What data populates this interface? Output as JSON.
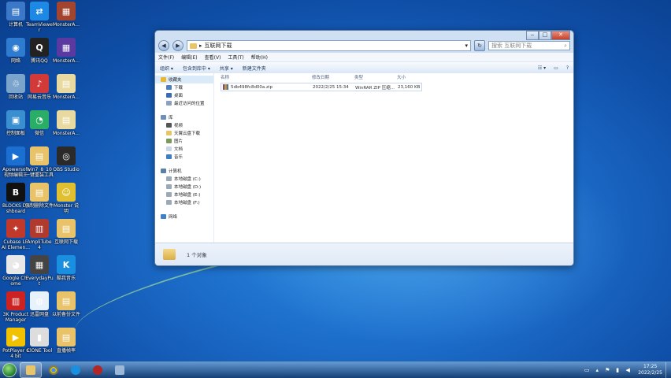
{
  "desktop_icons": [
    {
      "label": "计算机",
      "color": "#3b78c8",
      "glyph": "▤"
    },
    {
      "label": "TeamViewer",
      "color": "#1e88e5",
      "glyph": "⇄"
    },
    {
      "label": "MonsterA...",
      "color": "#a3442e",
      "glyph": "▦"
    },
    {
      "label": "网络",
      "color": "#2f7bd0",
      "glyph": "◉"
    },
    {
      "label": "腾讯QQ",
      "color": "#222",
      "glyph": "Q"
    },
    {
      "label": "MonsterA...",
      "color": "#5a3aa0",
      "glyph": "▦"
    },
    {
      "label": "回收站",
      "color": "#7aa4cc",
      "glyph": "♲"
    },
    {
      "label": "网易云音乐",
      "color": "#d23a3a",
      "glyph": "♪"
    },
    {
      "label": "MonsterA...",
      "color": "#e8d9a0",
      "glyph": "▤"
    },
    {
      "label": "控制面板",
      "color": "#3a8fd0",
      "glyph": "▣"
    },
    {
      "label": "微信",
      "color": "#2aae67",
      "glyph": "◔"
    },
    {
      "label": "MonsterA...",
      "color": "#e8d9a0",
      "glyph": "▤"
    },
    {
      "label": "Apowersoft视频编辑王",
      "color": "#1b6fd1",
      "glyph": "▶"
    },
    {
      "label": "win7_8_10一键重装工具",
      "color": "#e8c36a",
      "glyph": "▤"
    },
    {
      "label": "OBS Studio",
      "color": "#2a2a2a",
      "glyph": "◎"
    },
    {
      "label": "BLOCKS Dashboard",
      "color": "#111",
      "glyph": "B"
    },
    {
      "label": "强制删除文件",
      "color": "#e8c36a",
      "glyph": "▤"
    },
    {
      "label": "Monster 说明",
      "color": "#e0c030",
      "glyph": "☺"
    },
    {
      "label": "Cubase LE AI Elemen...",
      "color": "#c0392b",
      "glyph": "✦"
    },
    {
      "label": "AmpliTube 4",
      "color": "#b03a2e",
      "glyph": "▥"
    },
    {
      "label": "互联网下载",
      "color": "#e8c36a",
      "glyph": "▤"
    },
    {
      "label": "Google Chrome",
      "color": "#e8e8e8",
      "glyph": "◕"
    },
    {
      "label": "EverydayPut",
      "color": "#444",
      "glyph": "▦"
    },
    {
      "label": "酷我音乐",
      "color": "#1a8fe0",
      "glyph": "K"
    },
    {
      "label": "3K Product Manager",
      "color": "#c22",
      "glyph": "▥"
    },
    {
      "label": "迅雷网盘",
      "color": "#e8f2fb",
      "glyph": "◍"
    },
    {
      "label": "以前备份文件",
      "color": "#e8c36a",
      "glyph": "▤"
    },
    {
      "label": "PotPlayer 64 bit",
      "color": "#f2c200",
      "glyph": "▶"
    },
    {
      "label": "ClONE Tool",
      "color": "#ddd",
      "glyph": "▮"
    },
    {
      "label": "直播帧率",
      "color": "#e8c36a",
      "glyph": "▤"
    }
  ],
  "window": {
    "address_path": "互联网下载",
    "search_placeholder": "搜索 互联网下载",
    "menu": [
      "文件(F)",
      "编辑(E)",
      "查看(V)",
      "工具(T)",
      "帮助(H)"
    ],
    "toolbar": [
      "组织 ▾",
      "包含到库中 ▾",
      "共享 ▾",
      "新建文件夹"
    ],
    "nav": {
      "favorites": {
        "label": "收藏夹",
        "items": [
          "下载",
          "桌面",
          "最近访问的位置"
        ]
      },
      "libraries": {
        "label": "库",
        "items": [
          "视频",
          "天翼云盘下载",
          "图片",
          "文档",
          "音乐"
        ]
      },
      "computer": {
        "label": "计算机",
        "items": [
          "本地磁盘 (C:)",
          "本地磁盘 (D:)",
          "本地磁盘 (E:)",
          "本地磁盘 (F:)"
        ]
      },
      "network": {
        "label": "网络"
      }
    },
    "columns": {
      "name": "名称",
      "date": "修改日期",
      "type": "类型",
      "size": "大小"
    },
    "files": [
      {
        "name": "5db498fc8d00a.zip",
        "date": "2022/2/25 15:34",
        "type": "WinRAR ZIP 压缩...",
        "size": "23,160 KB"
      }
    ],
    "status": "1 个对象"
  },
  "taskbar": {
    "time": "17:25",
    "date": "2022/2/25"
  }
}
